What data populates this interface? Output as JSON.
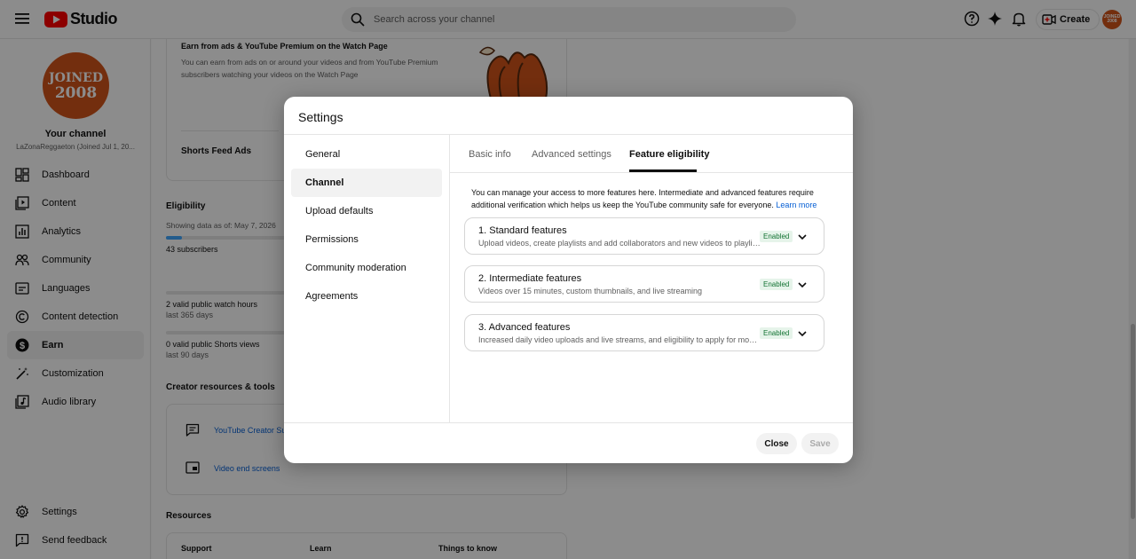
{
  "header": {
    "logo_text": "Studio",
    "search_placeholder": "Search across your channel",
    "create_label": "Create",
    "avatar_text": "JOINED 2008",
    "brand_color": "#ff0000"
  },
  "sidebar": {
    "avatar_line1": "JOINED",
    "avatar_line2": "2008",
    "channel_title": "Your channel",
    "channel_sub": "LaZonaReggaeton (Joined Jul 1, 20...",
    "items": [
      {
        "label": "Dashboard",
        "icon": "dashboard-icon"
      },
      {
        "label": "Content",
        "icon": "content-icon"
      },
      {
        "label": "Analytics",
        "icon": "analytics-icon"
      },
      {
        "label": "Community",
        "icon": "community-icon"
      },
      {
        "label": "Languages",
        "icon": "languages-icon"
      },
      {
        "label": "Content detection",
        "icon": "copyright-icon"
      },
      {
        "label": "Earn",
        "icon": "dollar-icon",
        "active": true
      },
      {
        "label": "Customization",
        "icon": "wand-icon"
      },
      {
        "label": "Audio library",
        "icon": "audio-library-icon"
      }
    ],
    "bottom": [
      {
        "label": "Settings",
        "icon": "gear-icon"
      },
      {
        "label": "Send feedback",
        "icon": "feedback-icon"
      }
    ]
  },
  "background_page": {
    "earn_card_title": "Earn from ads & YouTube Premium on the Watch Page",
    "earn_card_desc_1": "You can earn from ads on or around your videos and from YouTube Premium",
    "earn_card_desc_2": "subscribers watching your videos on the Watch Page",
    "shorts_feed_ads": "Shorts Feed Ads",
    "eligibility_title": "Eligibility",
    "showing_data": "Showing data as of: May 7, 2026",
    "subscribers": "43 subscribers",
    "subscribers_progress": 0.06,
    "watch_hours": "2 valid public watch hours",
    "watch_hours_period": "last 365 days",
    "shorts_views": "0 valid public Shorts views",
    "shorts_views_period": "last 90 days",
    "creator_resources_title": "Creator resources & tools",
    "creator_link_1": "YouTube Creator Sup",
    "creator_link_2": "Video end screens",
    "resources_title": "Resources",
    "resources_cols": [
      "Support",
      "Learn",
      "Things to know"
    ]
  },
  "modal": {
    "title": "Settings",
    "nav": [
      {
        "label": "General"
      },
      {
        "label": "Channel",
        "active": true
      },
      {
        "label": "Upload defaults"
      },
      {
        "label": "Permissions"
      },
      {
        "label": "Community moderation"
      },
      {
        "label": "Agreements"
      }
    ],
    "tabs": [
      "Basic info",
      "Advanced settings",
      "Feature eligibility"
    ],
    "active_tab": "Feature eligibility",
    "intro_text": "You can manage your access to more features here. Intermediate and advanced features require additional verification which helps us keep the YouTube community safe for everyone.",
    "learn_more": "Learn more",
    "features": [
      {
        "title": "1. Standard features",
        "desc": "Upload videos, create playlists and add collaborators and new videos to playlists",
        "status": "Enabled"
      },
      {
        "title": "2. Intermediate features",
        "desc": "Videos over 15 minutes, custom thumbnails, and live streaming",
        "status": "Enabled"
      },
      {
        "title": "3. Advanced features",
        "desc": "Increased daily video uploads and live streams, and eligibility to apply for moneti...",
        "status": "Enabled"
      }
    ],
    "close_label": "Close",
    "save_label": "Save",
    "accent_color": "#065fd4",
    "enabled_color": "#137333"
  }
}
